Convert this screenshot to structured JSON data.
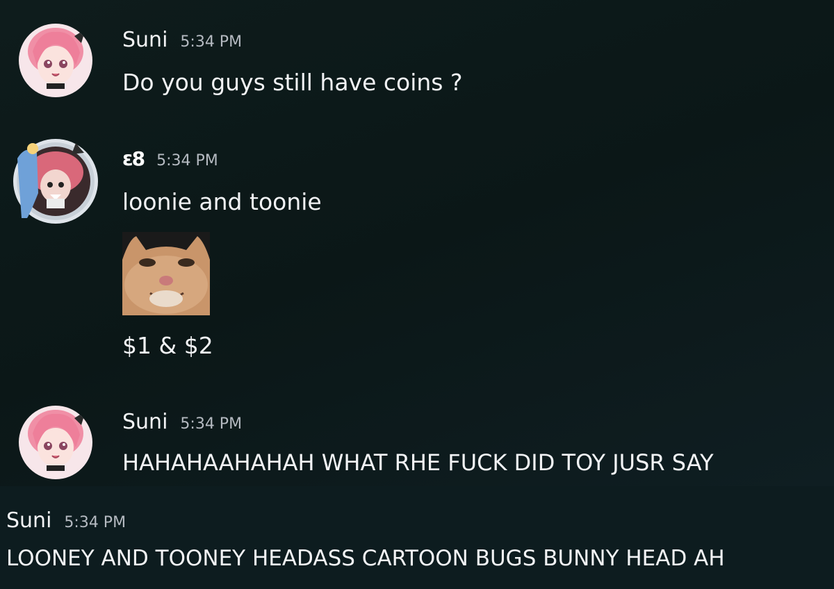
{
  "messages": [
    {
      "username": "Suni",
      "timestamp": "5:34 PM",
      "lines": [
        "Do you guys still have coins ?"
      ],
      "avatar_icon": "anime-girl-pink-hair-avatar"
    },
    {
      "username": "ε8",
      "timestamp": "5:34 PM",
      "lines": [
        "loonie and toonie",
        "$1 & $2"
      ],
      "avatar_icon": "anime-character-avatar-with-decoration",
      "emoji_icon": "smiling-cat-emoji"
    },
    {
      "username": "Suni",
      "timestamp": "5:34 PM",
      "lines": [
        "HAHAHAAHAHAH WHAT RHE FUCK DID TOY JUSR SAY"
      ],
      "avatar_icon": "anime-girl-pink-hair-avatar"
    },
    {
      "username": "Suni",
      "timestamp": "5:34 PM",
      "lines": [
        "LOONEY AND TOONEY HEADASS CARTOON BUGS BUNNY HEAD AH"
      ]
    }
  ],
  "colors": {
    "background": "#0d1a1a",
    "text": "#f2f3f5",
    "timestamp": "#b5bac1"
  }
}
